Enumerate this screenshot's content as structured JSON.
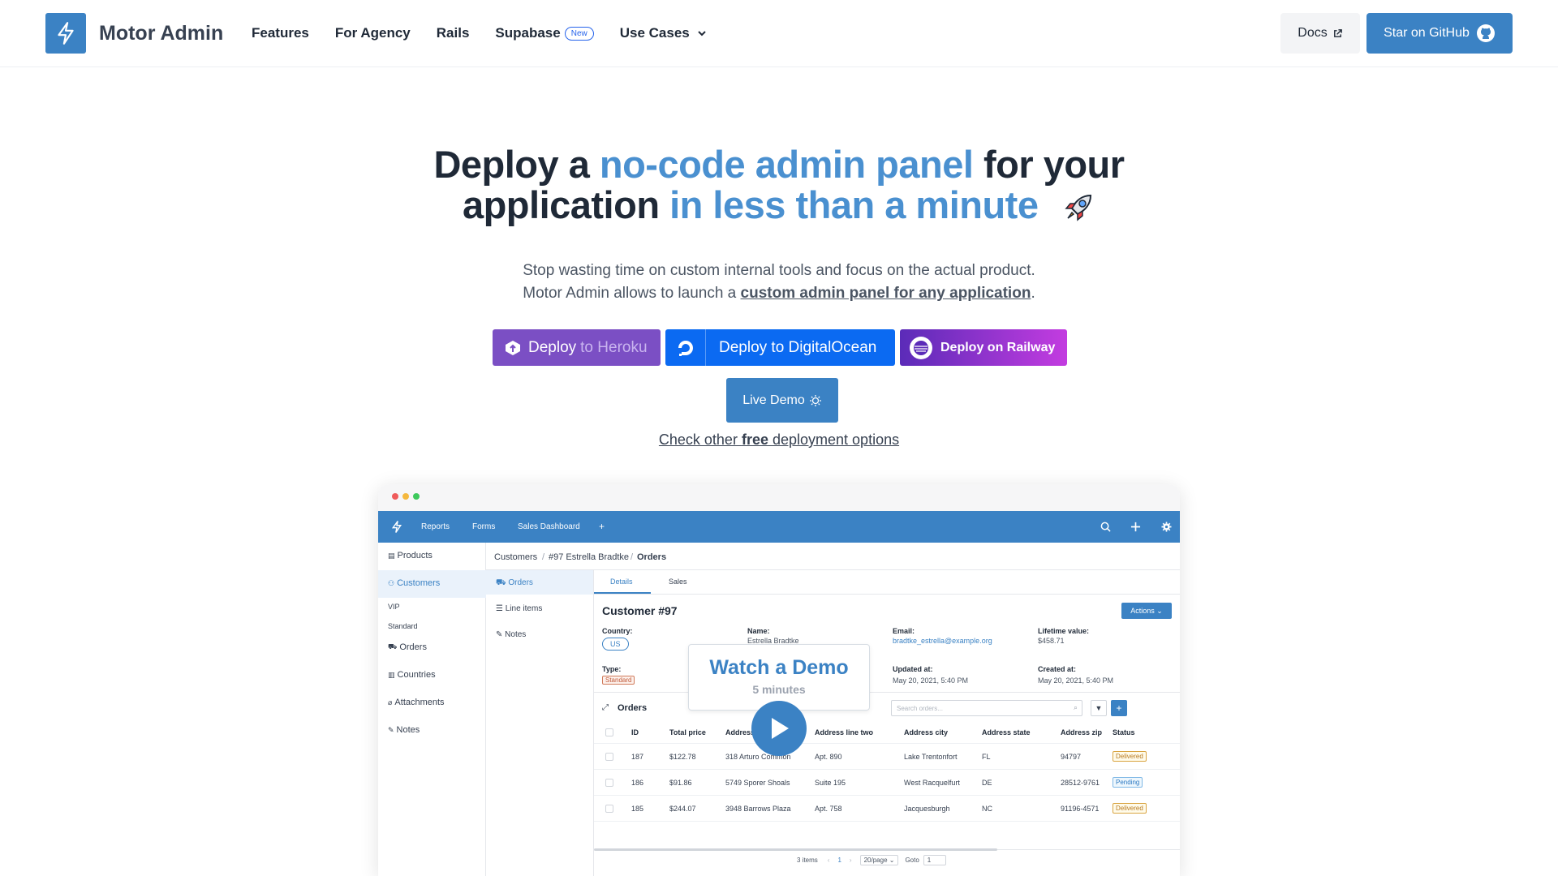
{
  "nav": {
    "brand": "Motor Admin",
    "links": [
      "Features",
      "For Agency",
      "Rails",
      "Supabase",
      "Use Cases"
    ],
    "new_badge": "New",
    "docs_label": "Docs",
    "github_label": "Star on GitHub"
  },
  "hero": {
    "title_p1": "Deploy a ",
    "title_hl1": "no-code admin panel",
    "title_p2": " for your",
    "title_p3": "application ",
    "title_hl2": "in less than a minute",
    "sub_line1": "Stop wasting time on custom internal tools and focus on the actual product.",
    "sub_line2_pre": "Motor Admin allows to launch a ",
    "sub_line2_link": "custom admin panel for any application",
    "sub_line2_post": "."
  },
  "deploy": {
    "heroku_a": "Deploy",
    "heroku_b": "to Heroku",
    "digitalocean": "Deploy to DigitalOcean",
    "railway": "Deploy on Railway"
  },
  "live_demo": "Live Demo",
  "check_link": {
    "pre": "Check other ",
    "bold": "free",
    "post": " deployment options"
  },
  "app": {
    "topnav": [
      "Reports",
      "Forms",
      "Sales Dashboard",
      "+"
    ],
    "sidebar": [
      "Products",
      "Customers",
      "VIP",
      "Standard",
      "Orders",
      "Countries",
      "Attachments",
      "Notes"
    ],
    "breadcrumb": [
      "Customers",
      "#97 Estrella Bradtke",
      "Orders"
    ],
    "subnav": [
      "Orders",
      "Line items",
      "Notes"
    ],
    "tabs": [
      "Details",
      "Sales"
    ],
    "record_title": "Customer #97",
    "actions_label": "Actions",
    "fields": {
      "country_label": "Country:",
      "country_value": "US",
      "name_label": "Name:",
      "name_value": "Estrella Bradtke",
      "email_label": "Email:",
      "email_value": "bradtke_estrella@example.org",
      "lifetime_label": "Lifetime value:",
      "lifetime_value": "$458.71",
      "type_label": "Type:",
      "type_value": "Standard",
      "updated_label": "Updated at:",
      "updated_value": "May 20, 2021, 5:40 PM",
      "created_label": "Created at:",
      "created_value": "May 20, 2021, 5:40 PM"
    },
    "orders_title": "Orders",
    "search_placeholder": "Search orders...",
    "columns": [
      "ID",
      "Total price",
      "Address",
      "Address line two",
      "Address city",
      "Address state",
      "Address zip",
      "Status"
    ],
    "rows": [
      {
        "id": "187",
        "total": "$122.78",
        "address": "318 Arturo Common",
        "line2": "Apt. 890",
        "city": "Lake Trentonfort",
        "state": "FL",
        "zip": "94797",
        "status": "Delivered"
      },
      {
        "id": "186",
        "total": "$91.86",
        "address": "5749 Sporer Shoals",
        "line2": "Suite 195",
        "city": "West Racquelfurt",
        "state": "DE",
        "zip": "28512-9761",
        "status": "Pending"
      },
      {
        "id": "185",
        "total": "$244.07",
        "address": "3948 Barrows Plaza",
        "line2": "Apt. 758",
        "city": "Jacquesburgh",
        "state": "NC",
        "zip": "91196-4571",
        "status": "Delivered"
      }
    ],
    "pagination": {
      "count": "3 items",
      "page": "1",
      "per_page": "20/page",
      "goto_label": "Goto",
      "goto_value": "1"
    }
  },
  "demo": {
    "title": "Watch a Demo",
    "duration": "5 minutes"
  },
  "colors": {
    "accent": "#3b82c4",
    "highlight": "#4a90d0",
    "heroku": "#7b4fc4",
    "digitalocean": "#0b6af2"
  }
}
